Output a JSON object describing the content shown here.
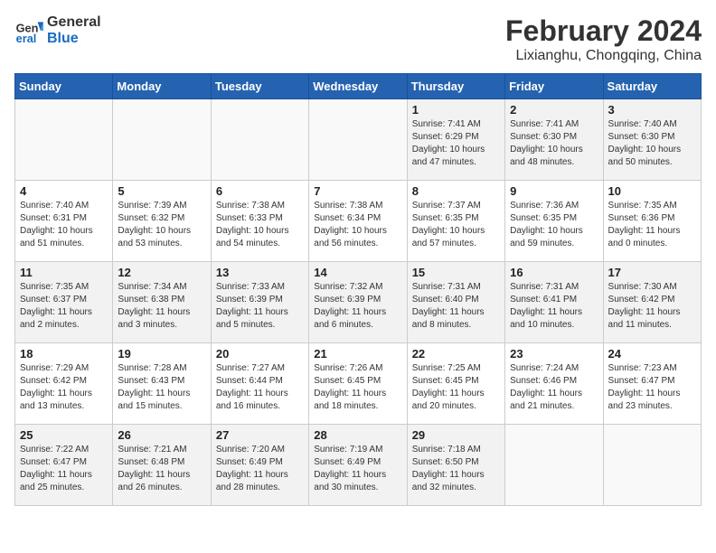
{
  "header": {
    "logo_line1": "General",
    "logo_line2": "Blue",
    "title": "February 2024",
    "subtitle": "Lixianghu, Chongqing, China"
  },
  "days_of_week": [
    "Sunday",
    "Monday",
    "Tuesday",
    "Wednesday",
    "Thursday",
    "Friday",
    "Saturday"
  ],
  "weeks": [
    [
      {
        "day": "",
        "info": ""
      },
      {
        "day": "",
        "info": ""
      },
      {
        "day": "",
        "info": ""
      },
      {
        "day": "",
        "info": ""
      },
      {
        "day": "1",
        "info": "Sunrise: 7:41 AM\nSunset: 6:29 PM\nDaylight: 10 hours\nand 47 minutes."
      },
      {
        "day": "2",
        "info": "Sunrise: 7:41 AM\nSunset: 6:30 PM\nDaylight: 10 hours\nand 48 minutes."
      },
      {
        "day": "3",
        "info": "Sunrise: 7:40 AM\nSunset: 6:30 PM\nDaylight: 10 hours\nand 50 minutes."
      }
    ],
    [
      {
        "day": "4",
        "info": "Sunrise: 7:40 AM\nSunset: 6:31 PM\nDaylight: 10 hours\nand 51 minutes."
      },
      {
        "day": "5",
        "info": "Sunrise: 7:39 AM\nSunset: 6:32 PM\nDaylight: 10 hours\nand 53 minutes."
      },
      {
        "day": "6",
        "info": "Sunrise: 7:38 AM\nSunset: 6:33 PM\nDaylight: 10 hours\nand 54 minutes."
      },
      {
        "day": "7",
        "info": "Sunrise: 7:38 AM\nSunset: 6:34 PM\nDaylight: 10 hours\nand 56 minutes."
      },
      {
        "day": "8",
        "info": "Sunrise: 7:37 AM\nSunset: 6:35 PM\nDaylight: 10 hours\nand 57 minutes."
      },
      {
        "day": "9",
        "info": "Sunrise: 7:36 AM\nSunset: 6:35 PM\nDaylight: 10 hours\nand 59 minutes."
      },
      {
        "day": "10",
        "info": "Sunrise: 7:35 AM\nSunset: 6:36 PM\nDaylight: 11 hours\nand 0 minutes."
      }
    ],
    [
      {
        "day": "11",
        "info": "Sunrise: 7:35 AM\nSunset: 6:37 PM\nDaylight: 11 hours\nand 2 minutes."
      },
      {
        "day": "12",
        "info": "Sunrise: 7:34 AM\nSunset: 6:38 PM\nDaylight: 11 hours\nand 3 minutes."
      },
      {
        "day": "13",
        "info": "Sunrise: 7:33 AM\nSunset: 6:39 PM\nDaylight: 11 hours\nand 5 minutes."
      },
      {
        "day": "14",
        "info": "Sunrise: 7:32 AM\nSunset: 6:39 PM\nDaylight: 11 hours\nand 6 minutes."
      },
      {
        "day": "15",
        "info": "Sunrise: 7:31 AM\nSunset: 6:40 PM\nDaylight: 11 hours\nand 8 minutes."
      },
      {
        "day": "16",
        "info": "Sunrise: 7:31 AM\nSunset: 6:41 PM\nDaylight: 11 hours\nand 10 minutes."
      },
      {
        "day": "17",
        "info": "Sunrise: 7:30 AM\nSunset: 6:42 PM\nDaylight: 11 hours\nand 11 minutes."
      }
    ],
    [
      {
        "day": "18",
        "info": "Sunrise: 7:29 AM\nSunset: 6:42 PM\nDaylight: 11 hours\nand 13 minutes."
      },
      {
        "day": "19",
        "info": "Sunrise: 7:28 AM\nSunset: 6:43 PM\nDaylight: 11 hours\nand 15 minutes."
      },
      {
        "day": "20",
        "info": "Sunrise: 7:27 AM\nSunset: 6:44 PM\nDaylight: 11 hours\nand 16 minutes."
      },
      {
        "day": "21",
        "info": "Sunrise: 7:26 AM\nSunset: 6:45 PM\nDaylight: 11 hours\nand 18 minutes."
      },
      {
        "day": "22",
        "info": "Sunrise: 7:25 AM\nSunset: 6:45 PM\nDaylight: 11 hours\nand 20 minutes."
      },
      {
        "day": "23",
        "info": "Sunrise: 7:24 AM\nSunset: 6:46 PM\nDaylight: 11 hours\nand 21 minutes."
      },
      {
        "day": "24",
        "info": "Sunrise: 7:23 AM\nSunset: 6:47 PM\nDaylight: 11 hours\nand 23 minutes."
      }
    ],
    [
      {
        "day": "25",
        "info": "Sunrise: 7:22 AM\nSunset: 6:47 PM\nDaylight: 11 hours\nand 25 minutes."
      },
      {
        "day": "26",
        "info": "Sunrise: 7:21 AM\nSunset: 6:48 PM\nDaylight: 11 hours\nand 26 minutes."
      },
      {
        "day": "27",
        "info": "Sunrise: 7:20 AM\nSunset: 6:49 PM\nDaylight: 11 hours\nand 28 minutes."
      },
      {
        "day": "28",
        "info": "Sunrise: 7:19 AM\nSunset: 6:49 PM\nDaylight: 11 hours\nand 30 minutes."
      },
      {
        "day": "29",
        "info": "Sunrise: 7:18 AM\nSunset: 6:50 PM\nDaylight: 11 hours\nand 32 minutes."
      },
      {
        "day": "",
        "info": ""
      },
      {
        "day": "",
        "info": ""
      }
    ]
  ]
}
